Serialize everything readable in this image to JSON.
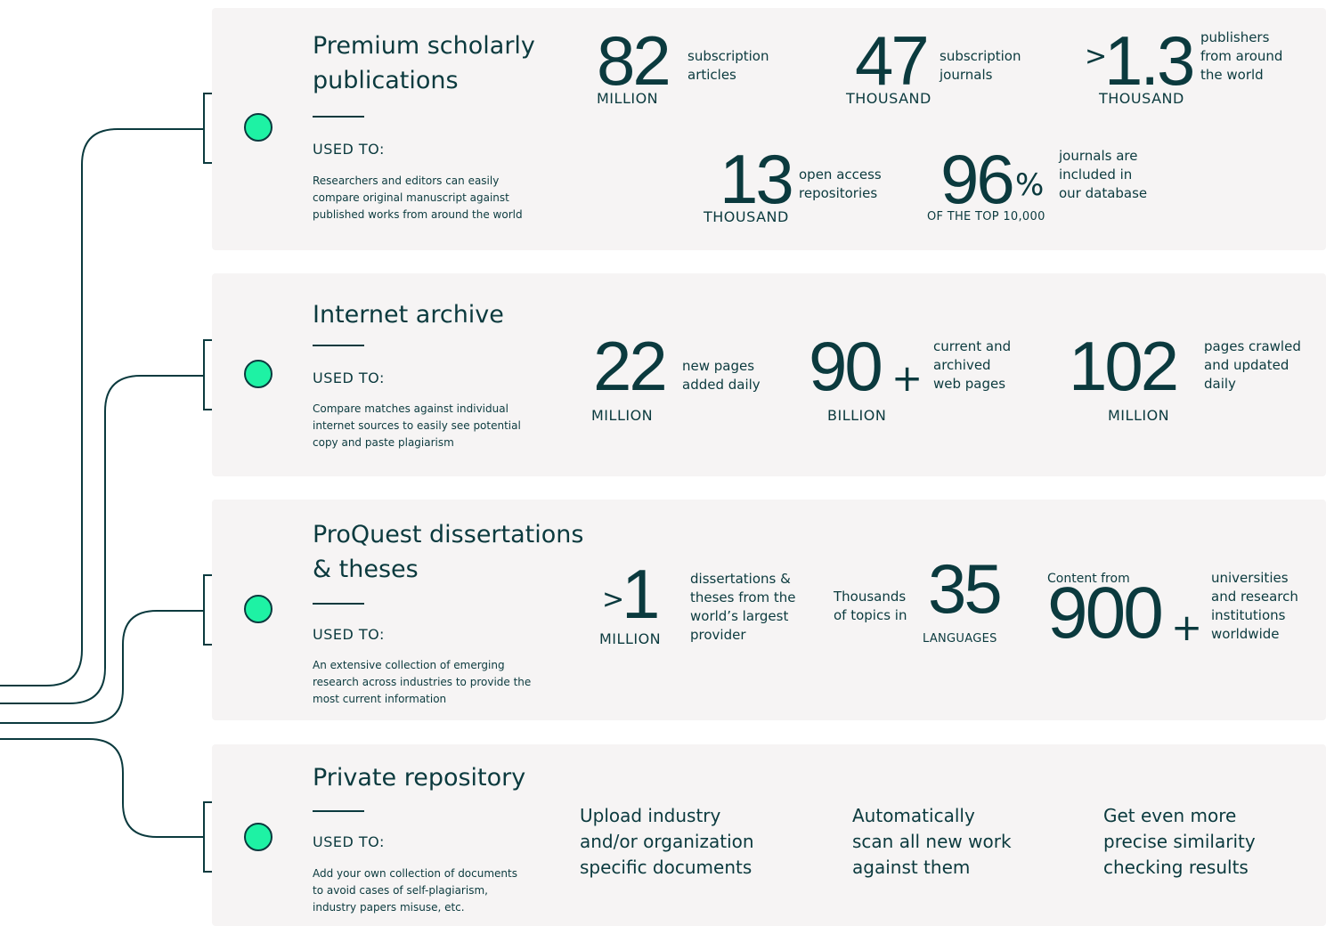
{
  "sections": {
    "premium": {
      "title_line1": "Premium scholarly",
      "title_line2": "publications",
      "used_to": "USED TO:",
      "desc_lines": [
        "Researchers and editors can easily",
        "compare original manuscript against",
        "published works from around the world"
      ],
      "stats": [
        {
          "value": "82",
          "unit": "MILLION",
          "label_lines": [
            "subscription",
            "articles"
          ]
        },
        {
          "value": "47",
          "unit": "THOUSAND",
          "label_lines": [
            "subscription",
            "journals"
          ]
        },
        {
          "prefix": ">",
          "value": "1.3",
          "unit": "THOUSAND",
          "label_lines": [
            "publishers",
            "from around",
            "the world"
          ]
        },
        {
          "value": "13",
          "unit": "THOUSAND",
          "label_lines": [
            "open access",
            "repositories"
          ]
        },
        {
          "value": "96",
          "suffix": "%",
          "unit": "OF THE TOP 10,000",
          "label_lines": [
            "journals  are",
            "included in",
            "our database"
          ]
        }
      ]
    },
    "internet": {
      "title": "Internet archive",
      "used_to": "USED TO:",
      "desc_lines": [
        "Compare matches against individual",
        "internet sources to easily see potential",
        "copy and paste plagiarism"
      ],
      "stats": [
        {
          "value": "22",
          "unit": "MILLION",
          "label_lines": [
            "new pages",
            "added daily"
          ]
        },
        {
          "value": "90",
          "suffix": "+",
          "unit": "BILLION",
          "label_lines": [
            "current and",
            "archived",
            "web pages"
          ]
        },
        {
          "value": "102",
          "unit": "MILLION",
          "label_lines": [
            "pages crawled",
            "and updated",
            "daily"
          ]
        }
      ]
    },
    "proquest": {
      "title_line1": "ProQuest dissertations",
      "title_line2": "& theses",
      "used_to": "USED TO:",
      "desc_lines": [
        "An extensive collection of emerging",
        "research across industries to provide the",
        "most current information"
      ],
      "stats": [
        {
          "prefix": ">",
          "value": "1",
          "unit": "MILLION",
          "label_lines": [
            "dissertations &",
            "theses from the",
            "world’s largest",
            "provider"
          ]
        },
        {
          "pre_label_lines": [
            "Thousands",
            "of topics in"
          ],
          "value": "35",
          "unit": "LANGUAGES"
        },
        {
          "pre_label": "Content from",
          "value": "900",
          "suffix": "+",
          "label_lines": [
            "universities",
            "and research",
            "institutions",
            "worldwide"
          ]
        }
      ]
    },
    "private": {
      "title": "Private repository",
      "used_to": "USED TO:",
      "desc_lines": [
        "Add your own collection of documents",
        "to avoid cases of self-plagiarism,",
        "industry papers misuse, etc."
      ],
      "features": [
        {
          "lines": [
            "Upload industry",
            "and/or organization",
            "specific documents"
          ]
        },
        {
          "lines": [
            "Automatically",
            "scan all new work",
            "against them"
          ]
        },
        {
          "lines": [
            "Get even more",
            "precise similarity",
            "checking results"
          ]
        }
      ]
    }
  },
  "colors": {
    "ink": "#0b3a3e",
    "accent": "#1ef2a4",
    "card": "#f6f4f4"
  }
}
